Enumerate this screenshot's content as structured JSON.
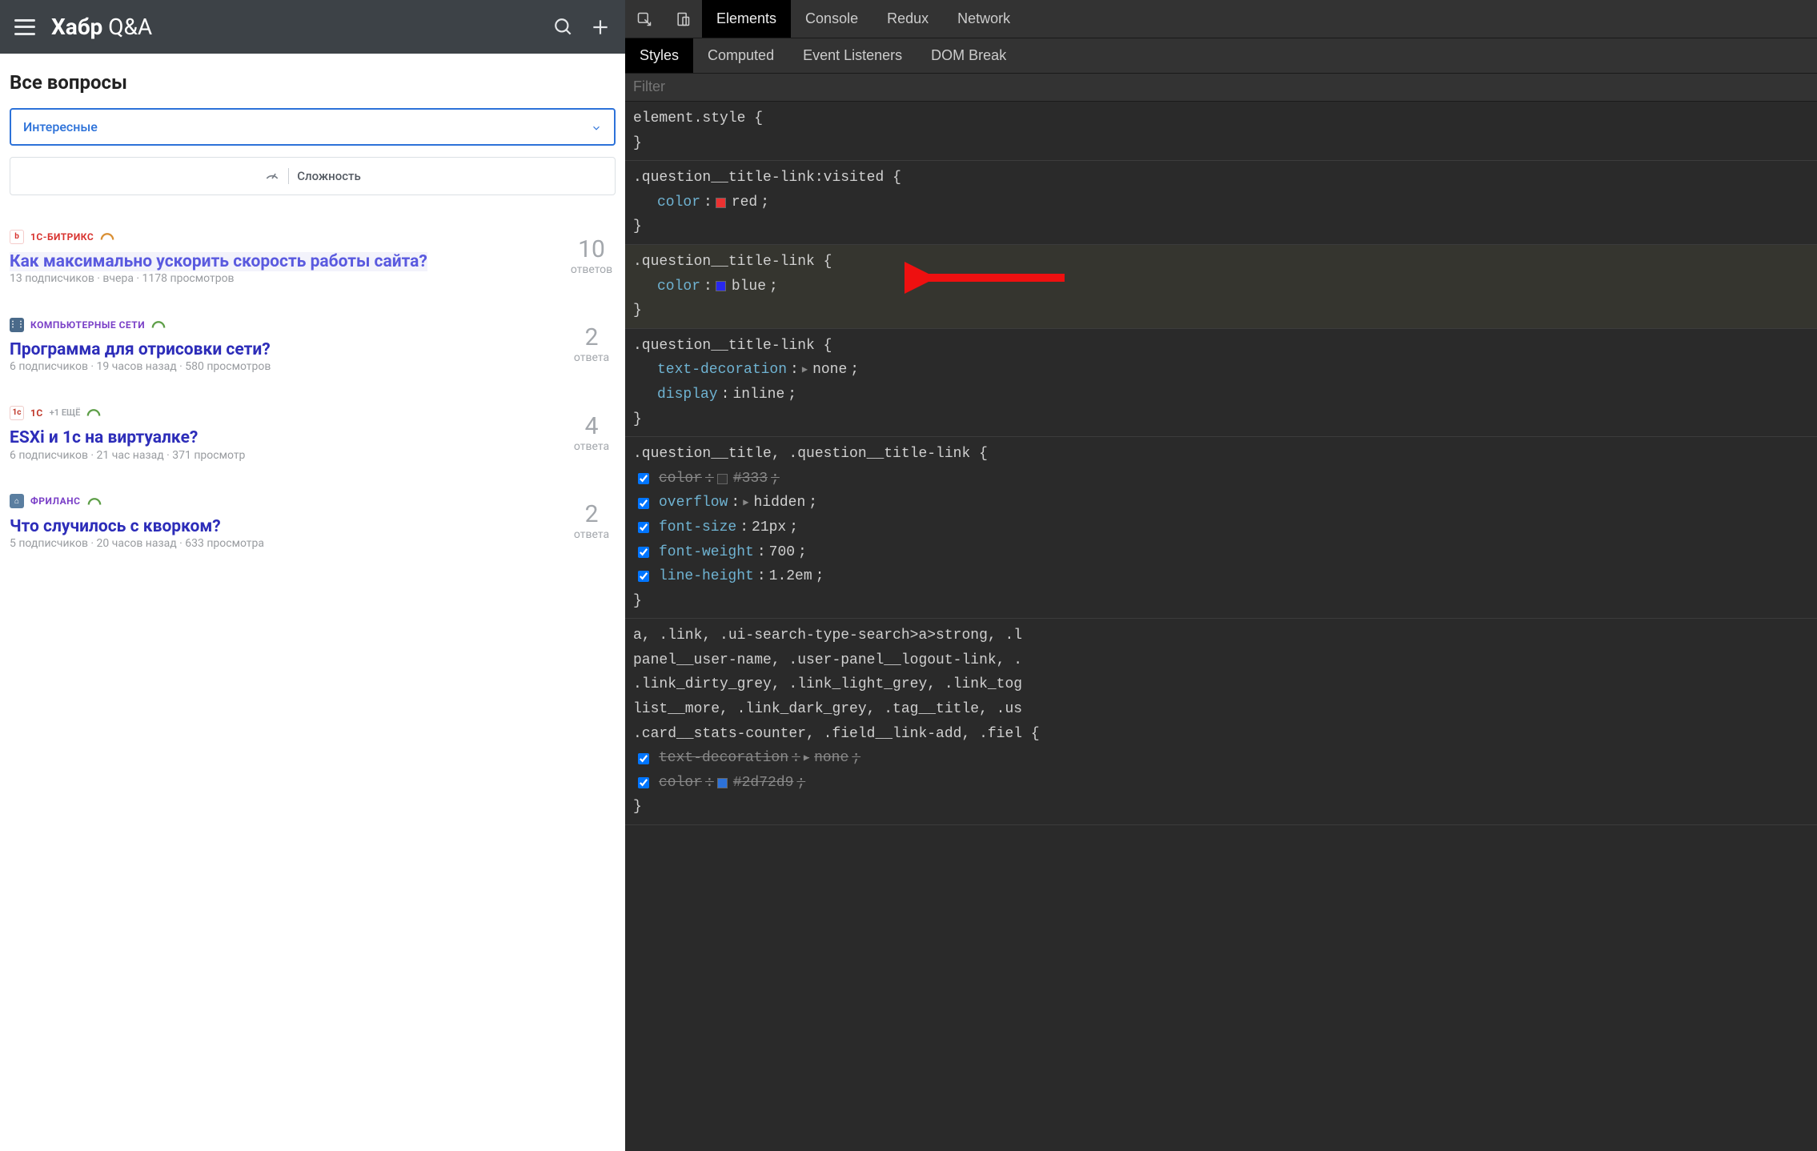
{
  "habr": {
    "logo_bold": "Хабр",
    "logo_light": " Q&A",
    "page_title": "Все вопросы",
    "filter_label": "Интересные",
    "complexity_label": "Сложность",
    "questions": [
      {
        "tag_color": "#d8332f",
        "tag_bg": "#fff",
        "tag_icon_text": "b",
        "tag_icon_style": "bitrix",
        "tag_name": "1С-БИТРИКС",
        "tag_name_color": "#d8332f",
        "arc_color": "#d98f33",
        "title": "Как максимально ускорить скорость работы сайта?",
        "visited": true,
        "meta": "13 подписчиков · вчера · 1178 просмотров",
        "count": "10",
        "count_label": "ответов",
        "extra": ""
      },
      {
        "tag_color": "#fff",
        "tag_bg": "#4a6a8a",
        "tag_icon_text": "⋮⋮",
        "tag_icon_style": "net",
        "tag_name": "КОМПЬЮТЕРНЫЕ СЕТИ",
        "tag_name_color": "#7a3fc7",
        "arc_color": "#5d9e47",
        "title": "Программа для отрисовки сети?",
        "visited": false,
        "meta": "6 подписчиков · 19 часов назад · 580 просмотров",
        "count": "2",
        "count_label": "ответа",
        "extra": ""
      },
      {
        "tag_color": "#c0392b",
        "tag_bg": "#fff",
        "tag_icon_text": "1c",
        "tag_icon_style": "onec",
        "tag_name": "1С",
        "tag_name_color": "#c0392b",
        "arc_color": "#5d9e47",
        "title": "ESXi и 1с на виртуалке?",
        "visited": false,
        "meta": "6 подписчиков · 21 час назад · 371 просмотр",
        "count": "4",
        "count_label": "ответа",
        "extra": "+1 ЕЩЁ"
      },
      {
        "tag_color": "#fff",
        "tag_bg": "#5a7ea0",
        "tag_icon_text": "⌂",
        "tag_icon_style": "free",
        "tag_name": "ФРИЛАНС",
        "tag_name_color": "#7a3fc7",
        "arc_color": "#5d9e47",
        "title": "Что случилось с кворком?",
        "visited": false,
        "meta": "5 подписчиков · 20 часов назад · 633 просмотра",
        "count": "2",
        "count_label": "ответа",
        "extra": ""
      }
    ]
  },
  "devtools": {
    "top_tabs": [
      "Elements",
      "Console",
      "Redux",
      "Network"
    ],
    "top_active": 0,
    "sub_tabs": [
      "Styles",
      "Computed",
      "Event Listeners",
      "DOM Break"
    ],
    "sub_active": 0,
    "filter_placeholder": "Filter",
    "rules": [
      {
        "selector": "element.style",
        "props": []
      },
      {
        "selector": ".question__title-link:visited",
        "props": [
          {
            "prop": "color",
            "val": "red",
            "swatch": "#eb3131",
            "checkbox": false
          }
        ]
      },
      {
        "selector": ".question__title-link",
        "highlighted": true,
        "arrow": true,
        "props": [
          {
            "prop": "color",
            "val": "blue",
            "swatch": "#2828ef",
            "checkbox": false
          }
        ]
      },
      {
        "selector": ".question__title-link",
        "props": [
          {
            "prop": "text-decoration",
            "val": "none",
            "tri": true
          },
          {
            "prop": "display",
            "val": "inline"
          }
        ]
      },
      {
        "selector": ".question__title, .question__title-link",
        "props": [
          {
            "prop": "color",
            "val": "#333",
            "swatch": "#333",
            "checkbox": true,
            "struck": true
          },
          {
            "prop": "overflow",
            "val": "hidden",
            "tri": true,
            "checkbox": true
          },
          {
            "prop": "font-size",
            "val": "21px",
            "checkbox": true
          },
          {
            "prop": "font-weight",
            "val": "700",
            "checkbox": true
          },
          {
            "prop": "line-height",
            "val": "1.2em",
            "checkbox": true
          }
        ]
      },
      {
        "selector_multiline": [
          "a, .link, .ui-search-type-search>a>strong, .l",
          "panel__user-name, .user-panel__logout-link, .",
          ".link_dirty_grey, .link_light_grey, .link_tog",
          "list__more, .link_dark_grey, .tag__title, .us",
          ".card__stats-counter, .field__link-add, .fiel"
        ],
        "props": [
          {
            "prop": "text-decoration",
            "val": "none",
            "tri": true,
            "checkbox": true,
            "struck": true
          },
          {
            "prop": "color",
            "val": "#2d72d9",
            "swatch": "#2d72d9",
            "checkbox": true,
            "struck": true
          }
        ]
      }
    ]
  }
}
